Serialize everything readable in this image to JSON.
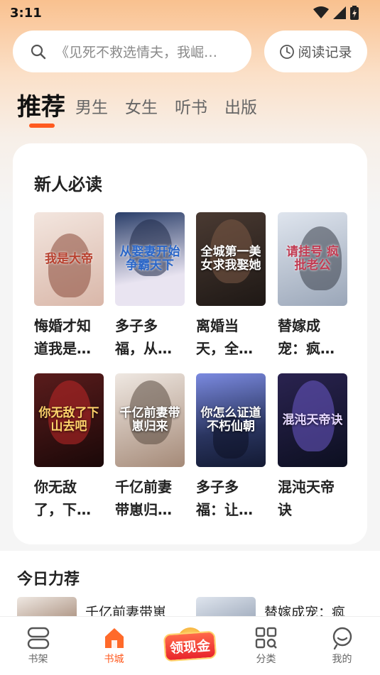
{
  "status_bar": {
    "time": "3:11"
  },
  "search": {
    "placeholder": "《见死不救选情夫，我崛…"
  },
  "history": {
    "label": "阅读记录"
  },
  "tabs": [
    {
      "label": "推荐",
      "active": true
    },
    {
      "label": "男生"
    },
    {
      "label": "女生"
    },
    {
      "label": "听书"
    },
    {
      "label": "出版"
    }
  ],
  "new_reader": {
    "title": "新人必读",
    "books": [
      {
        "title": "悔婚才知道我是…",
        "cover_text": "我是大帝",
        "color_a": "#f3e6df",
        "color_b": "#b8412f"
      },
      {
        "title": "多子多福，从…",
        "cover_text": "从娶妻开始争霸天下",
        "color_a": "#e9e4f1",
        "color_b": "#2a66c8"
      },
      {
        "title": "离婚当天，全…",
        "cover_text": "全城第一美女求我娶她",
        "color_a": "#3b2f2a",
        "color_b": "#7b5a45"
      },
      {
        "title": "替嫁成宠：疯…",
        "cover_text": "请挂号 疯批老公",
        "color_a": "#dfe5ee",
        "color_b": "#c23b52"
      },
      {
        "title": "你无敌了，下…",
        "cover_text": "你无敌了下山去吧",
        "color_a": "#3a1414",
        "color_b": "#b01f1f"
      },
      {
        "title": "千亿前妻带崽归…",
        "cover_text": "千亿前妻带崽归来",
        "color_a": "#e7e0dc",
        "color_b": "#8a5a3c"
      },
      {
        "title": "多子多福：让…",
        "cover_text": "你怎么证道不朽仙朝",
        "color_a": "#2a3560",
        "color_b": "#6b7bd0"
      },
      {
        "title": "混沌天帝诀",
        "cover_text": "混沌天帝诀",
        "color_a": "#151a33",
        "color_b": "#4b3a8a"
      }
    ]
  },
  "today": {
    "title": "今日力荐",
    "items": [
      {
        "title": "千亿前妻带崽"
      },
      {
        "title": "替嫁成宠：疯"
      }
    ]
  },
  "bottom_nav": [
    {
      "label": "书架",
      "icon": "bookshelf-icon"
    },
    {
      "label": "书城",
      "icon": "store-icon",
      "active": true
    },
    {
      "label": "领现金",
      "icon": "cash-icon"
    },
    {
      "label": "分类",
      "icon": "category-icon"
    },
    {
      "label": "我的",
      "icon": "profile-icon"
    }
  ],
  "colors": {
    "accent": "#ff5a1f",
    "header_top": "#f9c18f"
  }
}
